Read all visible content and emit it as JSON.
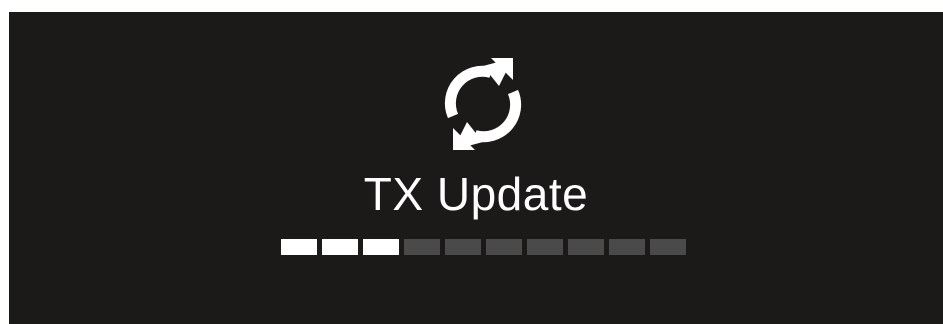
{
  "screen": {
    "icon": "sync-icon",
    "title": "TX Update",
    "background_color": "#1b1a19",
    "text_color": "#ffffff"
  },
  "progress": {
    "filled_segments": 3,
    "total_segments": 10,
    "fraction": 0.3,
    "filled_color": "#ffffff",
    "empty_color": "#4a4a4a"
  }
}
